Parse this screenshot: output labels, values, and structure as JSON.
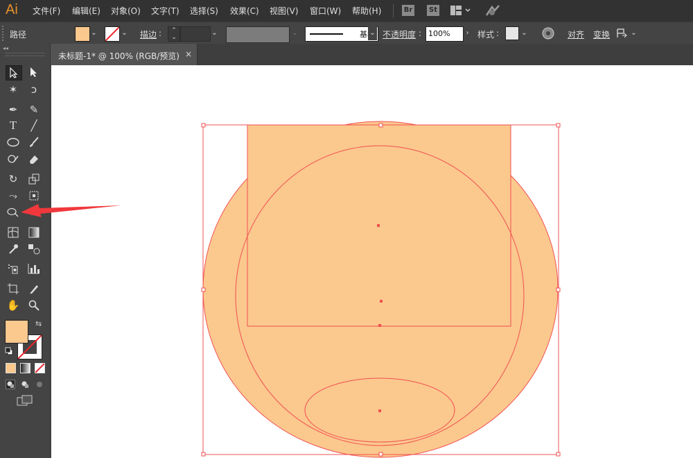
{
  "app": {
    "logo_text": "Ai"
  },
  "menu": {
    "items": [
      "文件(F)",
      "编辑(E)",
      "对象(O)",
      "文字(T)",
      "选择(S)",
      "效果(C)",
      "视图(V)",
      "窗口(W)",
      "帮助(H)"
    ],
    "bridge_label": "Br",
    "stock_label": "St"
  },
  "control_bar": {
    "selection_type": "路径",
    "fill_color": "#fbc88e",
    "stroke_label": "描边",
    "stroke_line_style": "基本",
    "opacity_label": "不透明度",
    "opacity_value": "100%",
    "style_label": "样式",
    "align_label": "对齐",
    "transform_label": "变换"
  },
  "document": {
    "tab_title": "未标题-1* @ 100% (RGB/预览)",
    "close_glyph": "×"
  },
  "toolbar": {
    "collapse_glyph": "◂◂",
    "fill_color": "#fbc88e",
    "stroke_color": "#ffffff",
    "tools": [
      {
        "name": "selection-tool-icon",
        "glyph": "▲"
      },
      {
        "name": "direct-selection-tool-icon",
        "glyph": "▶"
      },
      {
        "name": "magic-wand-tool-icon",
        "glyph": "✶"
      },
      {
        "name": "lasso-tool-icon",
        "glyph": "ↄ"
      },
      {
        "name": "pen-tool-icon",
        "glyph": "✒"
      },
      {
        "name": "curvature-tool-icon",
        "glyph": "✎"
      },
      {
        "name": "type-tool-icon",
        "glyph": "T"
      },
      {
        "name": "line-tool-icon",
        "glyph": "╱"
      },
      {
        "name": "ellipse-tool-icon",
        "glyph": "◯"
      },
      {
        "name": "paintbrush-tool-icon",
        "glyph": "🖌"
      },
      {
        "name": "shaper-tool-icon",
        "glyph": "✎"
      },
      {
        "name": "eraser-tool-icon",
        "glyph": "◆"
      },
      {
        "name": "rotate-tool-icon",
        "glyph": "↻"
      },
      {
        "name": "scale-tool-icon",
        "glyph": "⬚"
      },
      {
        "name": "warp-tool-icon",
        "glyph": "⤳"
      },
      {
        "name": "free-transform-tool-icon",
        "glyph": "⊡"
      },
      {
        "name": "shape-builder-tool-icon",
        "glyph": "⊕"
      },
      {
        "name": "perspective-grid-tool-icon",
        "glyph": "⧈"
      },
      {
        "name": "mesh-tool-icon",
        "glyph": "▦"
      },
      {
        "name": "gradient-tool-icon",
        "glyph": "◧"
      },
      {
        "name": "eyedropper-tool-icon",
        "glyph": "✐"
      },
      {
        "name": "blend-tool-icon",
        "glyph": "⧉"
      },
      {
        "name": "symbol-sprayer-tool-icon",
        "glyph": "⁘"
      },
      {
        "name": "column-graph-tool-icon",
        "glyph": "▥"
      },
      {
        "name": "artboard-tool-icon",
        "glyph": "⊏"
      },
      {
        "name": "slice-tool-icon",
        "glyph": "⟋"
      },
      {
        "name": "hand-tool-icon",
        "glyph": "✋"
      },
      {
        "name": "zoom-tool-icon",
        "glyph": "🔍"
      }
    ]
  },
  "annotation": {
    "arrow_color": "#f0383c"
  },
  "artwork": {
    "shape_fill": "#fbc88e",
    "selection_color": "#f05050"
  }
}
